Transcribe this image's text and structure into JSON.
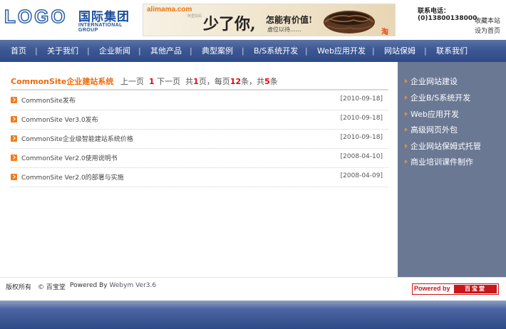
{
  "header": {
    "logo_text": "LOGO",
    "logo_cn": "国际集团",
    "logo_en": "INTERNATIONAL GROUP",
    "banner": {
      "brand": "alimama.com",
      "sub": "阿里妈妈",
      "big": "少了你,",
      "mid": "怎能有价值!",
      "small": "虚位以待……",
      "badge": "淘"
    },
    "hotline": "联系电话：(0)13800138000",
    "links": [
      "收藏本站",
      "设为首页"
    ]
  },
  "nav": {
    "items": [
      "首页",
      "关于我们",
      "企业新闻",
      "其他产品",
      "典型案例",
      "B/S系统开发",
      "Web应用开发",
      "网站保姆",
      "联系我们"
    ],
    "separator": "|"
  },
  "main": {
    "title": "CommonSite企业建站系统",
    "pager": {
      "prev": "上一页",
      "current": "1",
      "next": "下一页",
      "total_prefix": "共",
      "total_pages": "1",
      "total_suffix": "页，每页",
      "per_page": "12",
      "per_page_suffix": "条，共",
      "total_items": "5",
      "total_items_suffix": "条"
    },
    "news": [
      {
        "title": "CommonSite发布",
        "date": "[2010-09-18]"
      },
      {
        "title": "CommonSite Ver3.0发布",
        "date": "[2010-09-18]"
      },
      {
        "title": "CommonSite企业级智能建站系统价格",
        "date": "[2010-09-18]"
      },
      {
        "title": "CommonSite Ver2.0使用说明书",
        "date": "[2008-04-10]"
      },
      {
        "title": "CommonSite Ver2.0的部署与实施",
        "date": "[2008-04-09]"
      }
    ]
  },
  "sidebar": {
    "items": [
      "企业网站建设",
      "企业B/S系统开发",
      "Web应用开发",
      "高级网页外包",
      "企业网站保姆式托管",
      "商业培训课件制作"
    ]
  },
  "footer": {
    "copyright": "版权所有　© 百宝堂",
    "powered_label": "Powered By",
    "powered_version": "Webym Ver3.6",
    "badge_left": "Powered by",
    "badge_right": "百宝堂"
  },
  "colors": {
    "nav_bg": "#3c5793",
    "sidebar_bg": "#6b7894",
    "accent_orange": "#f0690a",
    "pager_red": "#ee0000"
  }
}
